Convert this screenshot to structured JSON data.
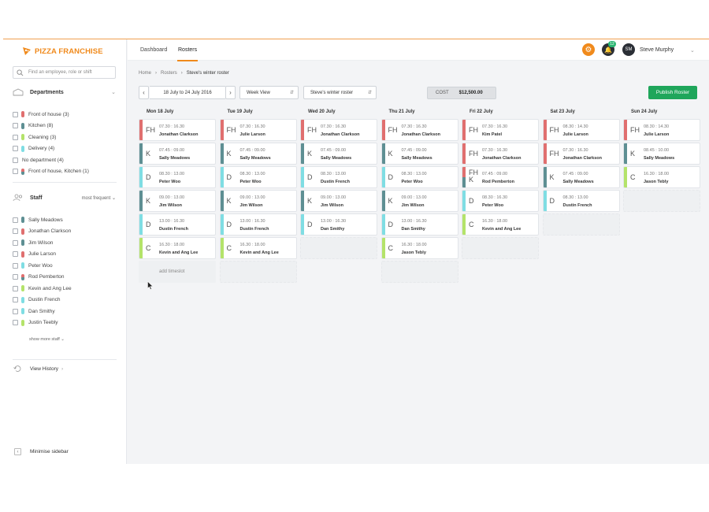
{
  "app": {
    "brand": "PIZZA FRANCHISE"
  },
  "colors": {
    "accent": "#f08a1c",
    "publish": "#1fa65b",
    "foh": "#e06f6f",
    "kitchen": "#5e8f93",
    "cleaning": "#b4e36a",
    "delivery": "#7fdde3"
  },
  "sidebar": {
    "search_placeholder": "Find an employee, role or shift",
    "departments_title": "Departments",
    "departments": [
      {
        "label": "Front of house (3)",
        "color": "#e06f6f"
      },
      {
        "label": "Kitchen (8)",
        "color": "#5e8f93"
      },
      {
        "label": "Cleaning (3)",
        "color": "#b4e36a"
      },
      {
        "label": "Delivery (4)",
        "color": "#7fdde3"
      },
      {
        "label": "No department (4)",
        "color": ""
      },
      {
        "label": "Front of house, Kitchen (1)",
        "color": "split"
      }
    ],
    "staff_title": "Staff",
    "staff_sort": "most frequent",
    "staff": [
      {
        "label": "Sally Meadows",
        "color": "#5e8f93"
      },
      {
        "label": "Jonathan Clarkson",
        "color": "#e06f6f"
      },
      {
        "label": "Jim Wilson",
        "color": "#5e8f93"
      },
      {
        "label": "Julie Larson",
        "color": "#e06f6f"
      },
      {
        "label": "Peter Woo",
        "color": "#7fdde3"
      },
      {
        "label": "Rod Pemberton",
        "color": "split"
      },
      {
        "label": "Kevin and Ang Lee",
        "color": "#b4e36a"
      },
      {
        "label": "Dustin French",
        "color": "#7fdde3"
      },
      {
        "label": "Dan Smithy",
        "color": "#7fdde3"
      },
      {
        "label": "Justin Teebly",
        "color": "#b4e36a"
      }
    ],
    "show_more": "show more staff",
    "view_history": "View History",
    "minimise": "Minimise sidebar"
  },
  "topbar": {
    "nav": [
      "Dashboard",
      "Rosters"
    ],
    "notifications": "12",
    "avatar_initials": "SM",
    "username": "Steve Murphy"
  },
  "breadcrumb": [
    "Home",
    "Rosters",
    "Steve's winter roster"
  ],
  "toolbar": {
    "date_range": "18 July to 24 July 2016",
    "view": "Week View",
    "roster": "Steve's winter roster",
    "cost_label": "COST",
    "cost_value": "$12,500.00",
    "publish": "Publish Roster"
  },
  "days": [
    {
      "label": "Mon 18 July",
      "shifts": [
        {
          "code": "FH",
          "time": "07.30 : 16.30",
          "name": "Jonathan Clarkson",
          "color": "#e06f6f"
        },
        {
          "code": "K",
          "time": "07.45 : 09.00",
          "name": "Sally Meadows",
          "color": "#5e8f93"
        },
        {
          "code": "D",
          "time": "08.30 : 13.00",
          "name": "Peter Woo",
          "color": "#7fdde3"
        },
        {
          "code": "K",
          "time": "09.00 : 13.00",
          "name": "Jim Wilson",
          "color": "#5e8f93"
        },
        {
          "code": "D",
          "time": "13.00 : 16.30",
          "name": "Dustin French",
          "color": "#7fdde3"
        },
        {
          "code": "C",
          "time": "16.30 : 18.00",
          "name": "Kevin and Ang Lee",
          "color": "#b4e36a"
        }
      ],
      "add": "add timeslot",
      "empties": 0
    },
    {
      "label": "Tue 19 July",
      "shifts": [
        {
          "code": "FH",
          "time": "07.30 : 16.30",
          "name": "Julie Larson",
          "color": "#e06f6f"
        },
        {
          "code": "K",
          "time": "07.45 : 09.00",
          "name": "Sally Meadows",
          "color": "#5e8f93"
        },
        {
          "code": "D",
          "time": "08.30 : 13.00",
          "name": "Peter Woo",
          "color": "#7fdde3"
        },
        {
          "code": "K",
          "time": "09.00 : 13.00",
          "name": "Jim Wilson",
          "color": "#5e8f93"
        },
        {
          "code": "D",
          "time": "13.00 : 16.30",
          "name": "Dustin French",
          "color": "#7fdde3"
        },
        {
          "code": "C",
          "time": "16.30 : 18.00",
          "name": "Kevin and Ang Lee",
          "color": "#b4e36a"
        }
      ],
      "empties": 1
    },
    {
      "label": "Wed 20 July",
      "shifts": [
        {
          "code": "FH",
          "time": "07.30 : 16.30",
          "name": "Jonathan Clarkson",
          "color": "#e06f6f"
        },
        {
          "code": "K",
          "time": "07.45 : 09.00",
          "name": "Sally Meadows",
          "color": "#5e8f93"
        },
        {
          "code": "D",
          "time": "08.30 : 13.00",
          "name": "Dustin French",
          "color": "#7fdde3"
        },
        {
          "code": "K",
          "time": "09.00 : 13.00",
          "name": "Jim Wilson",
          "color": "#5e8f93"
        },
        {
          "code": "D",
          "time": "13.00 : 16.30",
          "name": "Dan Smithy",
          "color": "#7fdde3"
        }
      ],
      "empties": 1
    },
    {
      "label": "Thu 21 July",
      "shifts": [
        {
          "code": "FH",
          "time": "07.30 : 16.30",
          "name": "Jonathan Clarkson",
          "color": "#e06f6f"
        },
        {
          "code": "K",
          "time": "07.45 : 09.00",
          "name": "Sally Meadows",
          "color": "#5e8f93"
        },
        {
          "code": "D",
          "time": "08.30 : 13.00",
          "name": "Peter Woo",
          "color": "#7fdde3"
        },
        {
          "code": "K",
          "time": "09.00 : 13.00",
          "name": "Jim Wilson",
          "color": "#5e8f93"
        },
        {
          "code": "D",
          "time": "13.00 : 16.30",
          "name": "Dan Smithy",
          "color": "#7fdde3"
        },
        {
          "code": "C",
          "time": "16.30 : 18.00",
          "name": "Jason Tebly",
          "color": "#b4e36a"
        }
      ],
      "empties": 1
    },
    {
      "label": "Fri 22 July",
      "shifts": [
        {
          "code": "FH",
          "time": "07.30 : 16.30",
          "name": "Kim Patel",
          "color": "#e06f6f"
        },
        {
          "code": "FH",
          "time": "07.30 : 16.30",
          "name": "Jonathan Clarkson",
          "color": "#e06f6f"
        },
        {
          "code": "FH K",
          "time": "07.45 : 09.00",
          "name": "Rod Pemberton",
          "color": "split"
        },
        {
          "code": "D",
          "time": "08.30 : 16.30",
          "name": "Peter Woo",
          "color": "#7fdde3"
        },
        {
          "code": "C",
          "time": "16.30 : 18.00",
          "name": "Kevin and Ang Lee",
          "color": "#b4e36a"
        }
      ],
      "empties": 1
    },
    {
      "label": "Sat 23 July",
      "shifts": [
        {
          "code": "FH",
          "time": "08.30 : 14.30",
          "name": "Julie Larson",
          "color": "#e06f6f"
        },
        {
          "code": "FH",
          "time": "07.30 : 16.30",
          "name": "Jonathan Clarkson",
          "color": "#e06f6f"
        },
        {
          "code": "K",
          "time": "07.45 : 09.00",
          "name": "Sally Meadows",
          "color": "#5e8f93"
        },
        {
          "code": "D",
          "time": "08.30 : 13.00",
          "name": "Dustin French",
          "color": "#7fdde3"
        }
      ],
      "empties": 1
    },
    {
      "label": "Sun 24 July",
      "shifts": [
        {
          "code": "FH",
          "time": "08.30 : 14.30",
          "name": "Julie Larson",
          "color": "#e06f6f"
        },
        {
          "code": "K",
          "time": "08.45 : 10.00",
          "name": "Sally Meadows",
          "color": "#5e8f93"
        },
        {
          "code": "C",
          "time": "16.30 : 18.00",
          "name": "Jason Tebly",
          "color": "#b4e36a"
        }
      ],
      "empties": 1
    }
  ]
}
